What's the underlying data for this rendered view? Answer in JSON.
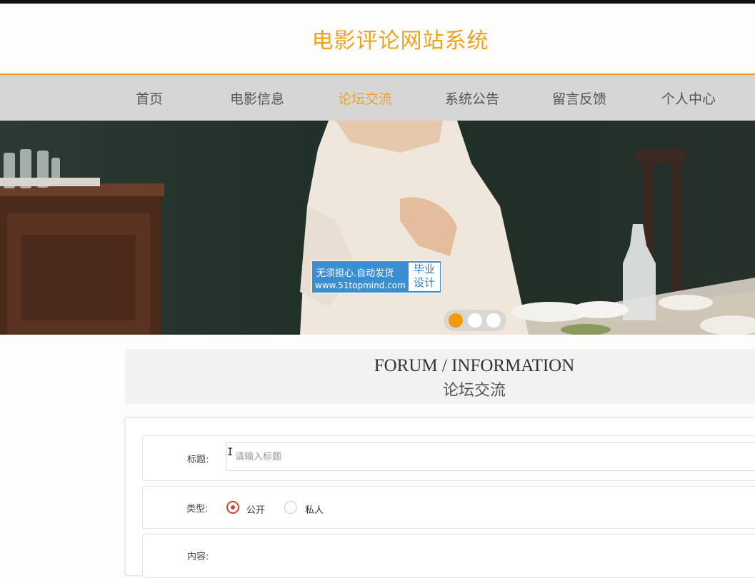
{
  "header": {
    "site_title": "电影评论网站系统"
  },
  "nav": {
    "items": [
      {
        "label": "首页"
      },
      {
        "label": "电影信息"
      },
      {
        "label": "论坛交流",
        "active": true
      },
      {
        "label": "系统公告"
      },
      {
        "label": "留言反馈"
      },
      {
        "label": "个人中心"
      }
    ]
  },
  "banner": {
    "watermark_line1": "无须担心.自动发货",
    "watermark_line2": "www.51topmind.com",
    "watermark_badge": "毕业设计",
    "active_slide": 1,
    "slide_count": 3
  },
  "section": {
    "title_en": "FORUM / INFORMATION",
    "title_cn": "论坛交流"
  },
  "form": {
    "title_label": "标题:",
    "title_placeholder": "请输入标题",
    "title_value": "",
    "type_label": "类型:",
    "type_options": [
      {
        "label": "公开",
        "selected": true
      },
      {
        "label": "私人",
        "selected": false
      }
    ],
    "content_label": "内容:"
  },
  "colors": {
    "accent": "#f0a21f",
    "nav_bg": "#d6d6d6",
    "radio_checked": "#d8412f",
    "watermark_bg": "#3a8fd3"
  }
}
